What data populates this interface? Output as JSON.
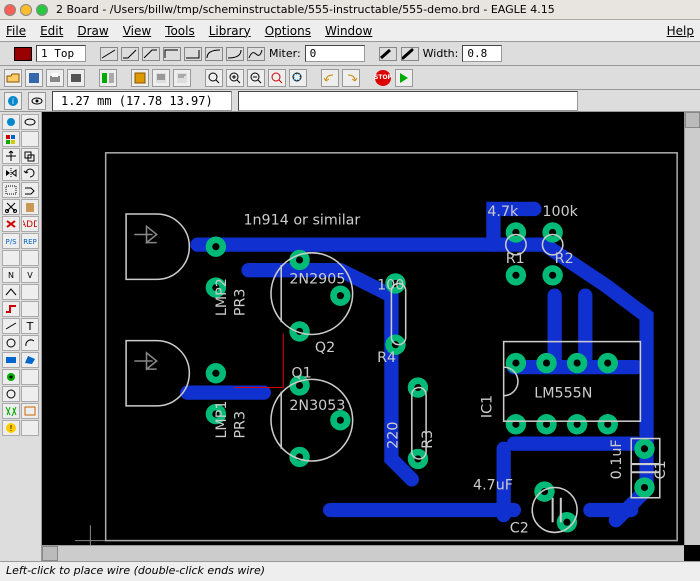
{
  "title": "2 Board - /Users/billw/tmp/scheminstructable/555-instructable/555-demo.brd - EAGLE 4.15",
  "menu": {
    "file": "File",
    "edit": "Edit",
    "draw": "Draw",
    "view": "View",
    "tools": "Tools",
    "library": "Library",
    "options": "Options",
    "window": "Window",
    "help": "Help"
  },
  "toolbar": {
    "layer": "1 Top",
    "miter_label": "Miter:",
    "miter_value": "0",
    "width_label": "Width:",
    "width_value": "0.8"
  },
  "coord": {
    "text": "1.27 mm (17.78 13.97)"
  },
  "status": {
    "text": "Left-click to place wire (double-click ends wire)"
  },
  "pcb": {
    "components": {
      "diode_label": "1n914 or similar",
      "q1": "Q1",
      "q2": "Q2",
      "q1_part": "2N3053",
      "q2_part": "2N2905",
      "r1": "R1",
      "r1_val": "4.7k",
      "r2": "R2",
      "r2_val": "100k",
      "r3": "R3",
      "r3_val": "220",
      "r4": "R4",
      "r4_val": "100",
      "c1": "C1",
      "c1_val": "0.1uF",
      "c2": "C2",
      "c2_val": "4.7uF",
      "ic1": "IC1",
      "ic_part": "LM555N",
      "lmp1": "LMP1",
      "lmp2": "LMP2",
      "pr3a": "PR3",
      "pr3b": "PR3"
    }
  },
  "colors": {
    "pad": "#0a8",
    "trace": "#00b",
    "outline": "#aaa",
    "text": "#ccc",
    "silk": "#ddd",
    "red": "#d00"
  }
}
